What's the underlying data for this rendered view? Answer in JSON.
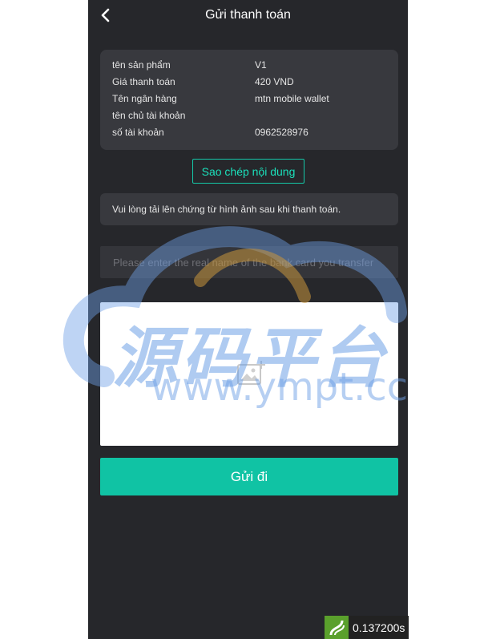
{
  "header": {
    "title": "Gửi thanh toán",
    "back_icon": "chevron-left-icon"
  },
  "info": [
    {
      "label": "tên sản phẩm",
      "value": "V1"
    },
    {
      "label": "Giá thanh toán",
      "value": "420 VND"
    },
    {
      "label": "Tên ngân hàng",
      "value": "mtn mobile wallet"
    },
    {
      "label": "tên chủ tài khoản",
      "value": ""
    },
    {
      "label": "số tài khoản",
      "value": "0962528976"
    }
  ],
  "copy_button": "Sao chép nội dung",
  "notice": "Vui lòng tải lên chứng từ hình ảnh sau khi thanh toán.",
  "name_input": {
    "placeholder": "Please enter the real name of the bank card you transfer",
    "value": ""
  },
  "upload": {
    "icon": "add-image-icon"
  },
  "submit_button": "Gửi đi",
  "watermark": {
    "cn": "源码平台",
    "url": "www.ympt.cc"
  },
  "timer": {
    "value": "0.137200s",
    "icon": "logo-icon"
  },
  "colors": {
    "background": "#26272b",
    "card": "#38393e",
    "accent": "#10c3a4"
  }
}
